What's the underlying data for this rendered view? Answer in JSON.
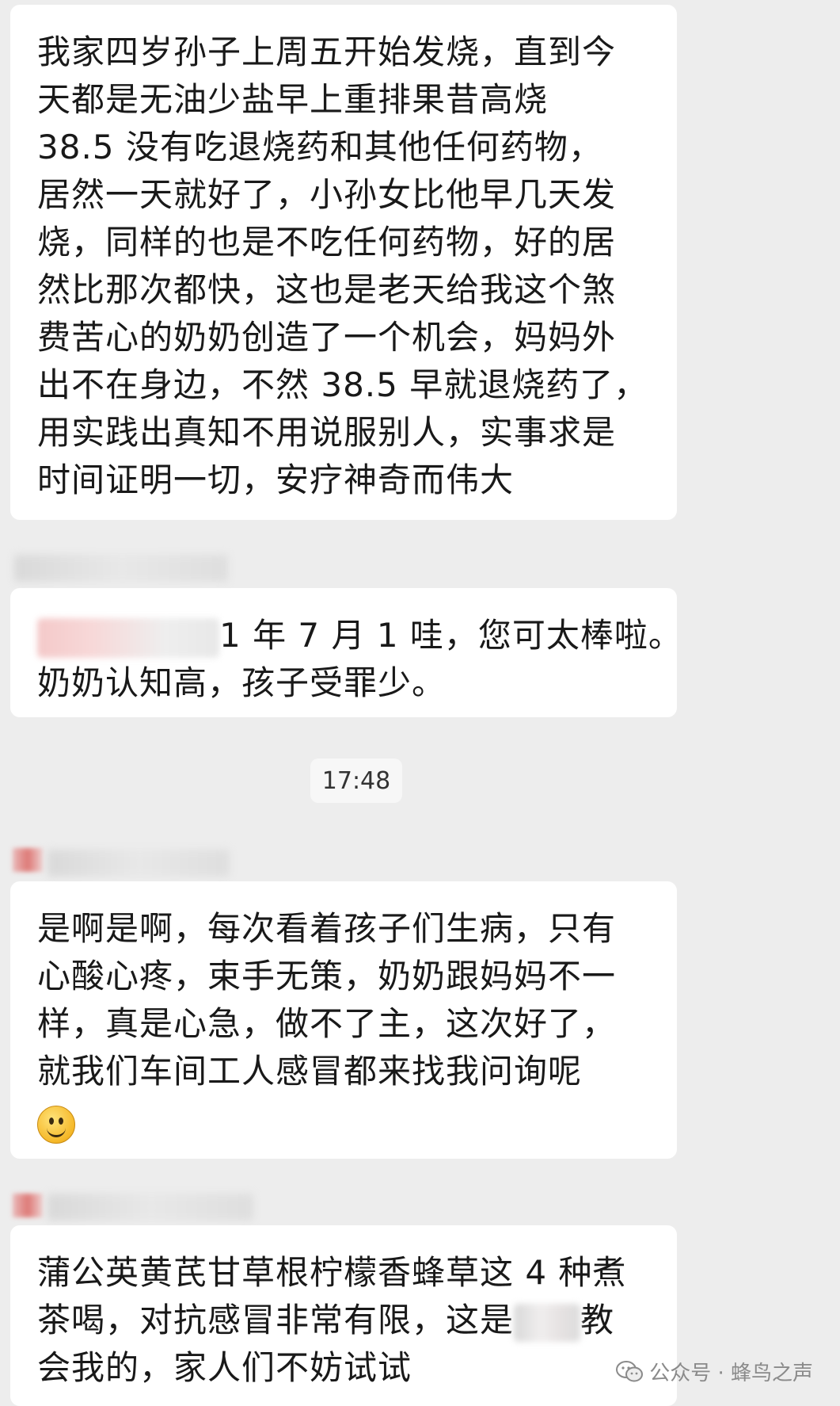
{
  "messages": {
    "m1": {
      "lines": [
        "我家四岁孙子上周五开始发烧，直到今",
        "天都是无油少盐早上重排果昔高烧",
        "38.5 没有吃退烧药和其他任何药物，",
        "居然一天就好了，小孙女比他早几天发",
        "烧，同样的也是不吃任何药物，好的居",
        "然比那次都快，这也是老天给我这个煞",
        "费苦心的奶奶创造了一个机会，妈妈外",
        "出不在身边，不然 38.5 早就退烧药了，",
        "用实践出真知不用说服别人，实事求是",
        "时间证明一切，安疗神奇而伟大"
      ]
    },
    "m2": {
      "line1_tail": "1 年 7 月 1  哇，您可太棒啦。",
      "line2": "奶奶认知高，孩子受罪少。"
    },
    "timestamp": "17:48",
    "m3": {
      "lines": [
        "是啊是啊，每次看着孩子们生病，只有",
        "心酸心疼，束手无策，奶奶跟妈妈不一",
        "样，真是心急，做不了主，这次好了，",
        "就我们车间工人感冒都来找我问询呢"
      ],
      "emoji": "smiley-emoji"
    },
    "m4": {
      "line1": "蒲公英黄芪甘草根柠檬香蜂草这 4 种煮",
      "line2_head": "茶喝，对抗感冒非常有限，这是",
      "line2_tail": "教",
      "line3": "会我的，家人们不妨试试"
    }
  },
  "watermark": {
    "text": "公众号 · 蜂鸟之声",
    "icon": "wechat-icon"
  }
}
